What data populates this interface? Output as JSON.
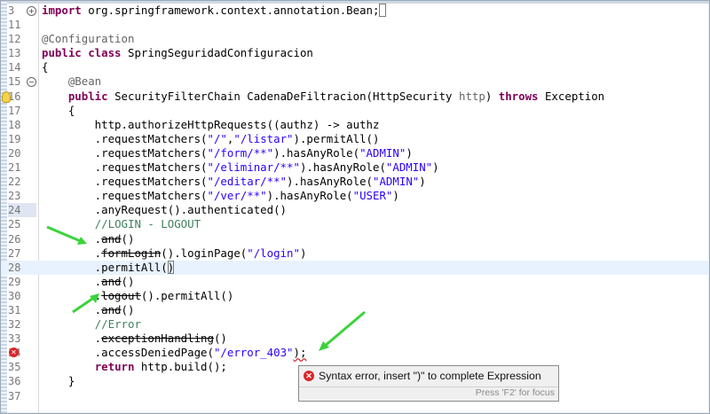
{
  "colors": {
    "keyword": "#7f0055",
    "string": "#2a00ff",
    "comment": "#3f7f5f",
    "annotation": "#646464",
    "arrow": "#3cd23c",
    "error": "#d8262a"
  },
  "editor": {
    "lines": [
      {
        "n": "3",
        "mark": "fold-plus",
        "current": false,
        "tokens": [
          {
            "t": "kw",
            "v": "import"
          },
          {
            "t": "",
            "v": " org.springframework.context.annotation.Bean;"
          },
          {
            "t": "box",
            "v": " "
          }
        ]
      },
      {
        "n": "11",
        "tokens": []
      },
      {
        "n": "12",
        "tokens": [
          {
            "t": "ann",
            "v": "@Configuration"
          }
        ]
      },
      {
        "n": "13",
        "tokens": [
          {
            "t": "kw",
            "v": "public class"
          },
          {
            "t": "",
            "v": " SpringSeguridadConfiguracion"
          }
        ]
      },
      {
        "n": "14",
        "tokens": [
          {
            "t": "",
            "v": "{"
          }
        ]
      },
      {
        "n": "15",
        "mark": "fold-minus",
        "tokens": [
          {
            "t": "",
            "v": "    "
          },
          {
            "t": "ann",
            "v": "@Bean"
          }
        ]
      },
      {
        "n": "16",
        "mark": "bulb",
        "tokens": [
          {
            "t": "",
            "v": "    "
          },
          {
            "t": "kw",
            "v": "public"
          },
          {
            "t": "",
            "v": " SecurityFilterChain CadenaDeFiltracion(HttpSecurity "
          },
          {
            "t": "ann",
            "v": "http"
          },
          {
            "t": "",
            "v": ") "
          },
          {
            "t": "kw",
            "v": "throws"
          },
          {
            "t": "",
            "v": " Exception"
          }
        ]
      },
      {
        "n": "17",
        "tokens": [
          {
            "t": "",
            "v": "    {"
          }
        ]
      },
      {
        "n": "18",
        "tokens": [
          {
            "t": "",
            "v": "        http.authorizeHttpRequests((authz) -> authz"
          }
        ]
      },
      {
        "n": "19",
        "tokens": [
          {
            "t": "",
            "v": "        .requestMatchers("
          },
          {
            "t": "str",
            "v": "\"/\""
          },
          {
            "t": "",
            "v": ","
          },
          {
            "t": "str",
            "v": "\"/listar\""
          },
          {
            "t": "",
            "v": ").permitAll()"
          }
        ]
      },
      {
        "n": "20",
        "tokens": [
          {
            "t": "",
            "v": "        .requestMatchers("
          },
          {
            "t": "str",
            "v": "\"/form/**\""
          },
          {
            "t": "",
            "v": ").hasAnyRole("
          },
          {
            "t": "str",
            "v": "\"ADMIN\""
          },
          {
            "t": "",
            "v": ")"
          }
        ]
      },
      {
        "n": "21",
        "tokens": [
          {
            "t": "",
            "v": "        .requestMatchers("
          },
          {
            "t": "str",
            "v": "\"/eliminar/**\""
          },
          {
            "t": "",
            "v": ").hasAnyRole("
          },
          {
            "t": "str",
            "v": "\"ADMIN\""
          },
          {
            "t": "",
            "v": ")"
          }
        ]
      },
      {
        "n": "22",
        "tokens": [
          {
            "t": "",
            "v": "        .requestMatchers("
          },
          {
            "t": "str",
            "v": "\"/editar/**\""
          },
          {
            "t": "",
            "v": ").hasAnyRole("
          },
          {
            "t": "str",
            "v": "\"ADMIN\""
          },
          {
            "t": "",
            "v": ")"
          }
        ]
      },
      {
        "n": "23",
        "tokens": [
          {
            "t": "",
            "v": "        .requestMatchers("
          },
          {
            "t": "str",
            "v": "\"/ver/**\""
          },
          {
            "t": "",
            "v": ").hasAnyRole("
          },
          {
            "t": "str",
            "v": "\"USER\""
          },
          {
            "t": "",
            "v": ")"
          }
        ]
      },
      {
        "n": "24",
        "hl": true,
        "tokens": [
          {
            "t": "",
            "v": "        .anyRequest().authenticated()"
          }
        ]
      },
      {
        "n": "25",
        "tokens": [
          {
            "t": "",
            "v": "        "
          },
          {
            "t": "cm",
            "v": "//LOGIN - LOGOUT"
          }
        ]
      },
      {
        "n": "26",
        "tokens": [
          {
            "t": "",
            "v": "        ."
          },
          {
            "t": "strike",
            "v": "and"
          },
          {
            "t": "",
            "v": "()"
          }
        ]
      },
      {
        "n": "27",
        "tokens": [
          {
            "t": "",
            "v": "        ."
          },
          {
            "t": "strike",
            "v": "formLogin"
          },
          {
            "t": "",
            "v": "().loginPage("
          },
          {
            "t": "str",
            "v": "\"/login\""
          },
          {
            "t": "",
            "v": ")"
          }
        ]
      },
      {
        "n": "28",
        "current": true,
        "tokens": [
          {
            "t": "",
            "v": "        .permitAll("
          },
          {
            "t": "box",
            "v": ")"
          }
        ]
      },
      {
        "n": "29",
        "tokens": [
          {
            "t": "",
            "v": "        ."
          },
          {
            "t": "strike",
            "v": "and"
          },
          {
            "t": "",
            "v": "()"
          }
        ]
      },
      {
        "n": "30",
        "tokens": [
          {
            "t": "",
            "v": "        ."
          },
          {
            "t": "strike",
            "v": "logout"
          },
          {
            "t": "",
            "v": "().permitAll()"
          }
        ]
      },
      {
        "n": "31",
        "tokens": [
          {
            "t": "",
            "v": "        ."
          },
          {
            "t": "strike",
            "v": "and"
          },
          {
            "t": "",
            "v": "()"
          }
        ]
      },
      {
        "n": "32",
        "tokens": [
          {
            "t": "",
            "v": "        "
          },
          {
            "t": "cm",
            "v": "//Error"
          }
        ]
      },
      {
        "n": "33",
        "tokens": [
          {
            "t": "",
            "v": "        ."
          },
          {
            "t": "strike",
            "v": "exceptionHandling"
          },
          {
            "t": "",
            "v": "()"
          }
        ]
      },
      {
        "n": "34",
        "mark": "error",
        "tokens": [
          {
            "t": "",
            "v": "        .accessDeniedPage("
          },
          {
            "t": "str",
            "v": "\"/error_403\""
          },
          {
            "t": "sq",
            "v": ");"
          }
        ]
      },
      {
        "n": "35",
        "tokens": [
          {
            "t": "",
            "v": "        "
          },
          {
            "t": "kw",
            "v": "return"
          },
          {
            "t": "",
            "v": " http.build();"
          }
        ]
      },
      {
        "n": "36",
        "tokens": [
          {
            "t": "",
            "v": "    }"
          }
        ]
      },
      {
        "n": "37",
        "tokens": []
      }
    ]
  },
  "tooltip": {
    "message": "Syntax error, insert \")\" to complete Expression",
    "hint": "Press 'F2' for focus"
  }
}
